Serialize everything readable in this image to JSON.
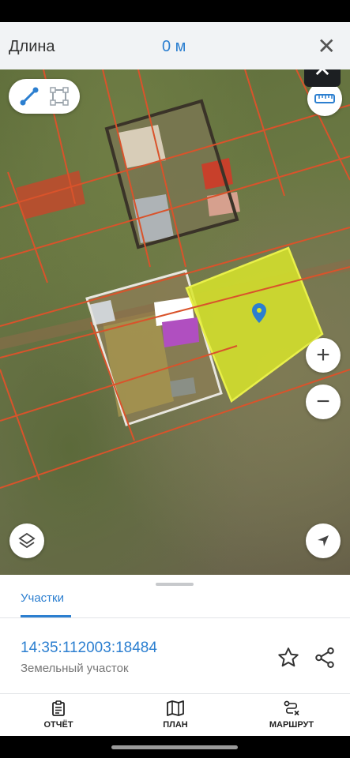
{
  "measure": {
    "title": "Длина",
    "value": "0 м",
    "close_glyph": "✕"
  },
  "map": {
    "overlay_close_glyph": "✕",
    "zoom_in_glyph": "+",
    "zoom_out_glyph": "−"
  },
  "sheet": {
    "tab_label": "Участки",
    "parcel_id": "14:35:112003:18484",
    "parcel_type": "Земельный участок"
  },
  "nav": {
    "report": "ОТЧЁТ",
    "plan": "ПЛАН",
    "route": "МАРШРУТ"
  },
  "colors": {
    "accent": "#2c7fd0",
    "parcel_fill": "#d8e52a",
    "cadastre_lines": "#d9532b",
    "highlight_purple": "#b04fc0"
  }
}
